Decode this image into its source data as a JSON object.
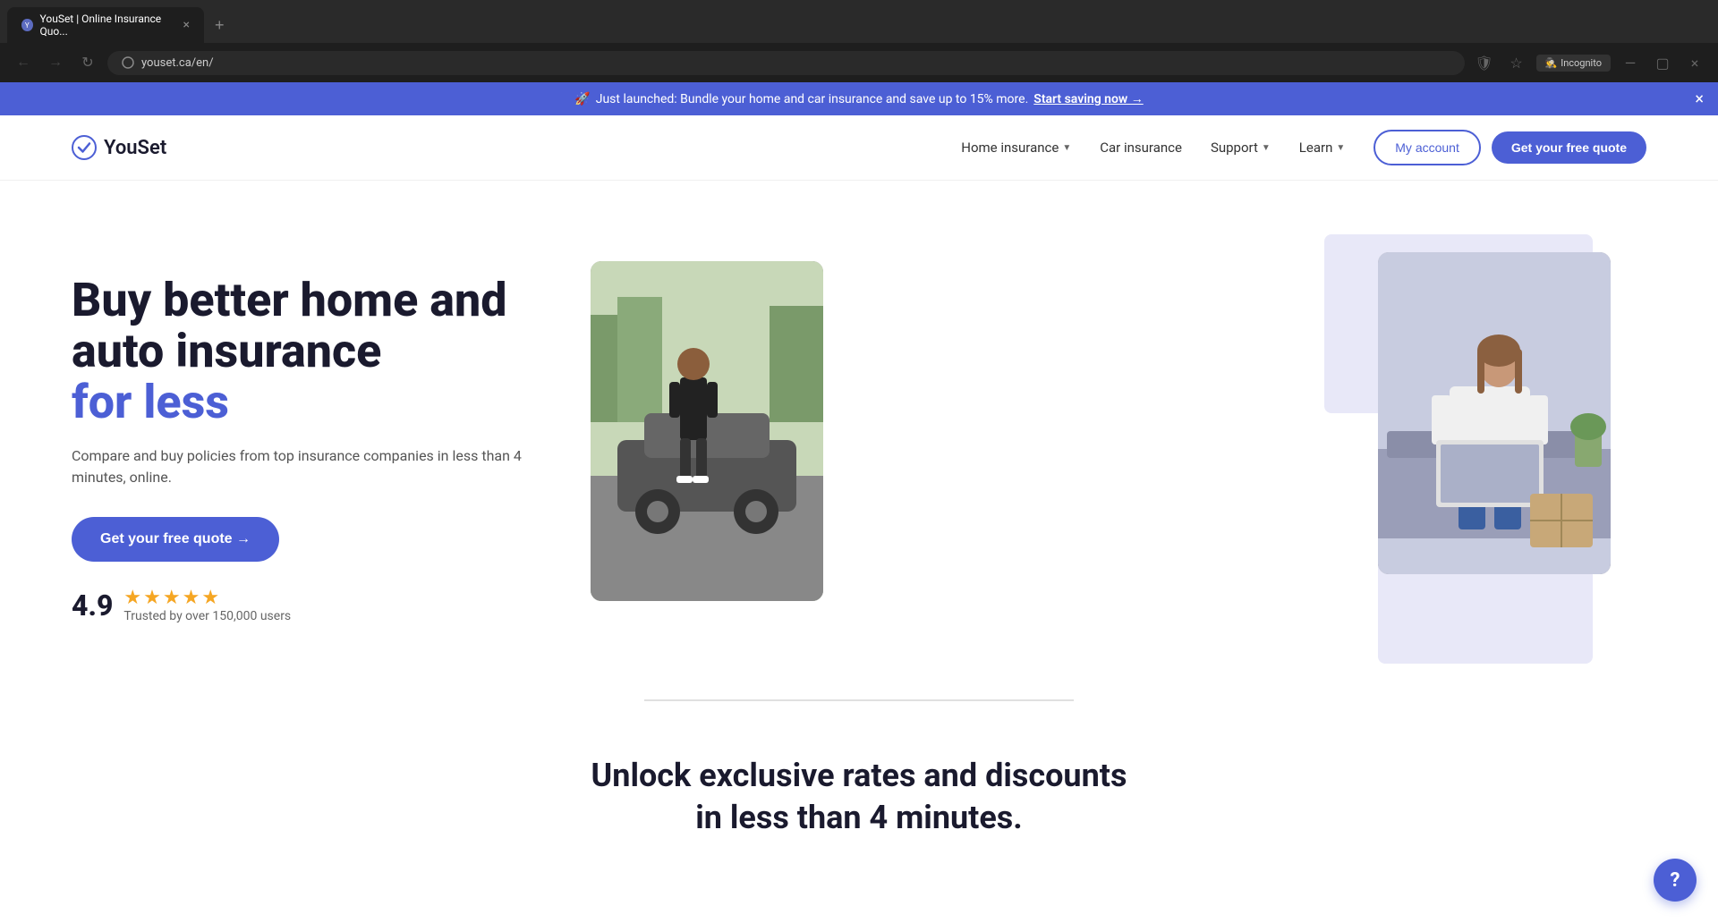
{
  "browser": {
    "tab_title": "YouSet | Online Insurance Quo...",
    "url": "youset.ca/en/",
    "tab_favicon": "Y",
    "new_tab_label": "+",
    "back_disabled": false,
    "forward_disabled": true,
    "incognito_label": "Incognito"
  },
  "banner": {
    "emoji": "🚀",
    "text": "Just launched: Bundle your home and car insurance and save up to 15% more.",
    "cta_text": "Start saving now →",
    "close_icon": "×"
  },
  "navbar": {
    "logo_text": "YouSet",
    "nav_links": [
      {
        "label": "Home insurance",
        "has_dropdown": true
      },
      {
        "label": "Car insurance",
        "has_dropdown": false
      },
      {
        "label": "Support",
        "has_dropdown": true
      },
      {
        "label": "Learn",
        "has_dropdown": true
      }
    ],
    "my_account_label": "My account",
    "cta_label": "Get your free quote"
  },
  "hero": {
    "title_line1": "Buy better home and",
    "title_line2": "auto insurance",
    "title_highlight": "for less",
    "description": "Compare and buy policies from top insurance companies in less than 4 minutes, online.",
    "cta_label": "Get your free quote →",
    "rating": {
      "number": "4.9",
      "stars": 5,
      "trust_text": "Trusted by over 150,000 users"
    }
  },
  "section_unlock": {
    "title": "Unlock exclusive rates and discounts in less than 4 minutes."
  },
  "help_btn": {
    "icon": "?"
  }
}
